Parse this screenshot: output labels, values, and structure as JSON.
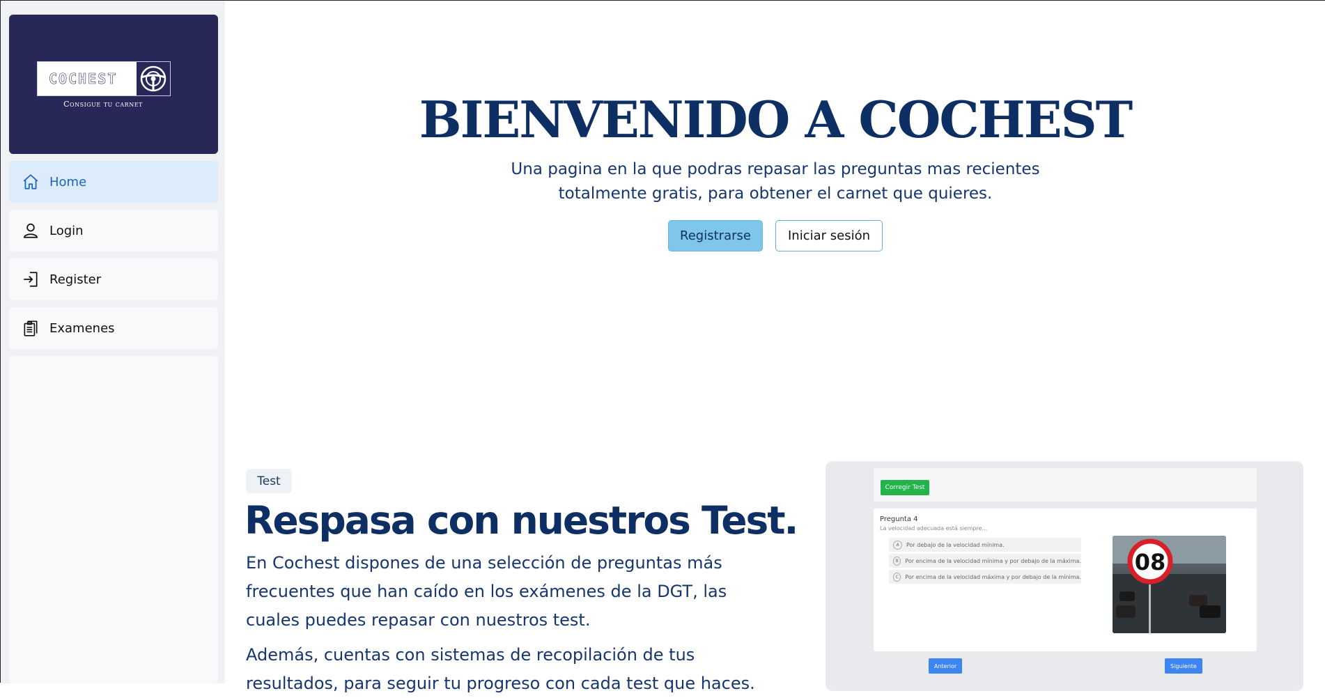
{
  "brand": {
    "name": "COCHEST",
    "tagline": "Consigue tu carnet"
  },
  "sidebar": {
    "items": [
      {
        "label": "Home",
        "icon": "home-icon"
      },
      {
        "label": "Login",
        "icon": "user-icon"
      },
      {
        "label": "Register",
        "icon": "sign-in-icon"
      },
      {
        "label": "Examenes",
        "icon": "clipboard-icon"
      }
    ]
  },
  "hero": {
    "title": "BIENVENIDO A COCHEST",
    "subtitle_line1": "Una pagina en la que podras repasar las preguntas mas recientes",
    "subtitle_line2": "totalmente gratis, para obtener el carnet que quieres.",
    "register_button": "Registrarse",
    "login_button": "Iniciar sesión"
  },
  "section": {
    "badge": "Test",
    "title": "Respasa con nuestros Test.",
    "p1_lines": [
      "En Cochest dispones de una selección de preguntas más",
      "frecuentes que han caído en los exámenes de la DGT, las",
      "cuales puedes repasar con nuestros test."
    ],
    "p2_lines": [
      "Además, cuentas con sistemas de recopilación de tus",
      "resultados, para seguir tu progreso con cada test que haces."
    ]
  },
  "preview": {
    "correct_button": "Corregir Test",
    "question_title": "Pregunta 4",
    "question_text": "La velocidad adecuada está siempre...",
    "options": [
      {
        "letter": "A",
        "text": "Por debajo de la velocidad mínima."
      },
      {
        "letter": "B",
        "text": "Por encima de la velocidad mínima y por debajo de la máxima."
      },
      {
        "letter": "C",
        "text": "Por encima de la velocidad máxima y por debajo de la mínima."
      }
    ],
    "sign_number": "08",
    "prev_button": "Anterior",
    "next_button": "Siguiente"
  },
  "colors": {
    "logo_bg": "#272858",
    "accent": "#0e2f64",
    "primary_button": "#7ec7ea",
    "active_nav": "#dcecfb"
  }
}
